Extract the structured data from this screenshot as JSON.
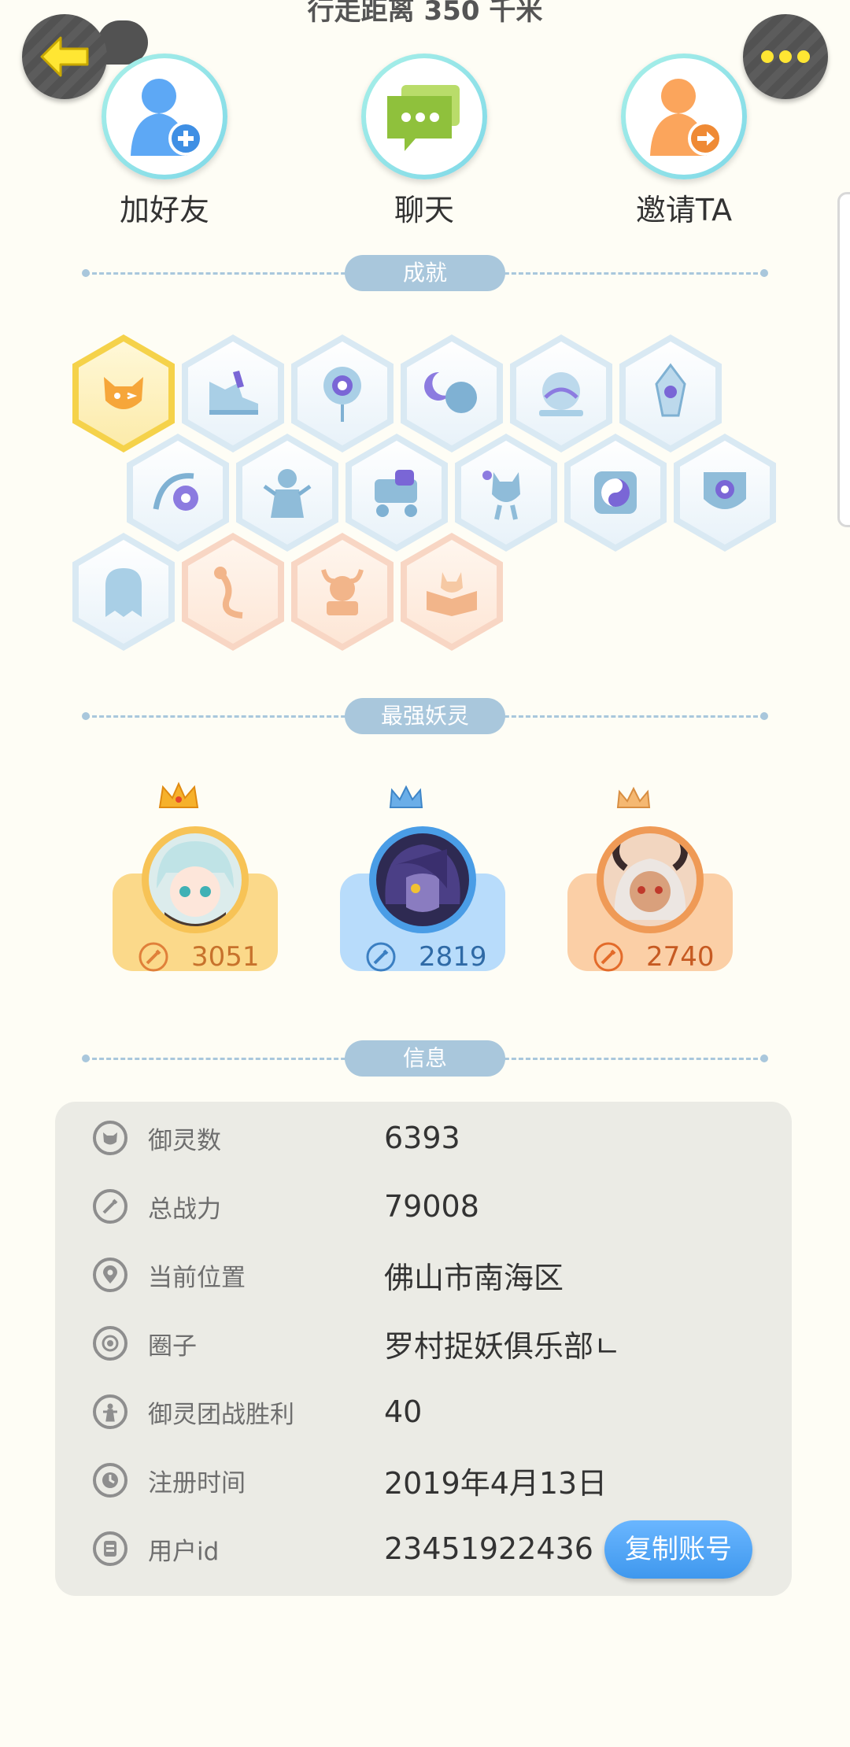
{
  "header": {
    "title": "行走距离 350 千米"
  },
  "actions": [
    {
      "label": "加好友"
    },
    {
      "label": "聊天"
    },
    {
      "label": "邀请TA"
    }
  ],
  "sections": {
    "achievements": "成就",
    "strongest": "最强妖灵",
    "info": "信息"
  },
  "strongest_spirits": [
    {
      "power": "3051",
      "theme": "gold"
    },
    {
      "power": "2819",
      "theme": "blue"
    },
    {
      "power": "2740",
      "theme": "orange"
    }
  ],
  "info": {
    "rows": [
      {
        "key": "御灵数",
        "value": "6393",
        "icon": "spirit-icon"
      },
      {
        "key": "总战力",
        "value": "79008",
        "icon": "sword-icon"
      },
      {
        "key": "当前位置",
        "value": "佛山市南海区",
        "icon": "location-pin-icon"
      },
      {
        "key": "圈子",
        "value": "罗村捉妖俱乐部ㄴ",
        "icon": "circle-target-icon"
      },
      {
        "key": "御灵团战胜利",
        "value": "40",
        "icon": "team-battle-icon"
      },
      {
        "key": "注册时间",
        "value": "2019年4月13日",
        "icon": "clock-icon"
      },
      {
        "key": "用户id",
        "value": "23451922436",
        "icon": "id-card-icon"
      }
    ],
    "copy_button": "复制账号"
  },
  "colors": {
    "background": "#fefdf5",
    "section_accent": "#a9c7dc",
    "copy_button": "#4aa3f5",
    "gold_card": "#fbd98a",
    "blue_card": "#b8dcfb",
    "orange_card": "#fbcfa6"
  }
}
